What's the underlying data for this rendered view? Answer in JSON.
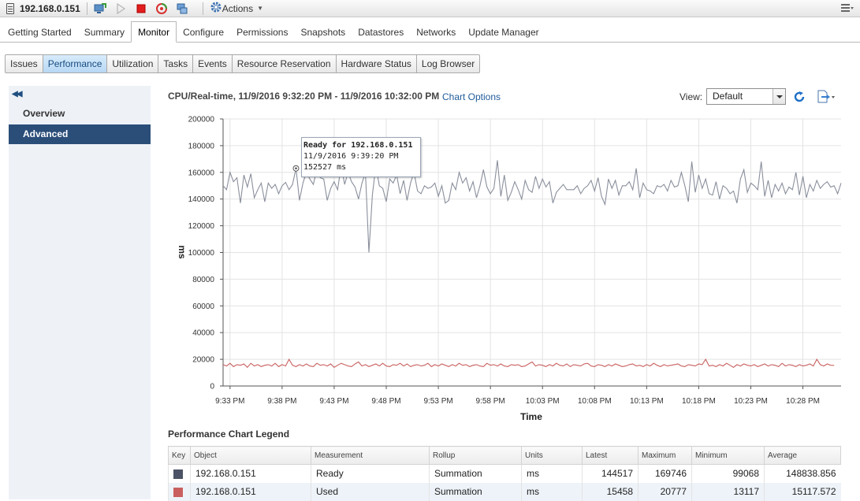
{
  "header": {
    "host_title": "192.168.0.151",
    "actions_label": "Actions",
    "icons": [
      "host-icon",
      "vm-console-icon",
      "power-on-icon",
      "power-off-icon",
      "restart-icon",
      "migrate-icon",
      "gear-icon",
      "chevron-down-icon",
      "menu-icon"
    ]
  },
  "main_tabs": [
    {
      "label": "Getting Started"
    },
    {
      "label": "Summary"
    },
    {
      "label": "Monitor",
      "active": true
    },
    {
      "label": "Configure"
    },
    {
      "label": "Permissions"
    },
    {
      "label": "Snapshots"
    },
    {
      "label": "Datastores"
    },
    {
      "label": "Networks"
    },
    {
      "label": "Update Manager"
    }
  ],
  "sub_tabs": [
    {
      "label": "Issues"
    },
    {
      "label": "Performance",
      "active": true
    },
    {
      "label": "Utilization"
    },
    {
      "label": "Tasks"
    },
    {
      "label": "Events"
    },
    {
      "label": "Resource Reservation"
    },
    {
      "label": "Hardware Status"
    },
    {
      "label": "Log Browser"
    }
  ],
  "side_nav": {
    "items": [
      {
        "label": "Overview"
      },
      {
        "label": "Advanced",
        "active": true
      }
    ]
  },
  "chart_header": {
    "title": "CPU/Real-time, 11/9/2016 9:32:20 PM - 11/9/2016 10:32:00 PM",
    "chart_options_label": "Chart Options",
    "view_label": "View:",
    "view_value": "Default"
  },
  "tooltip": {
    "title": "Ready for 192.168.0.151",
    "time": "11/9/2016 9:39:20 PM",
    "value": "152527 ms"
  },
  "chart_data": {
    "type": "line",
    "title": "CPU/Real-time, 11/9/2016 9:32:20 PM - 11/9/2016 10:32:00 PM",
    "xlabel": "Time",
    "ylabel": "ms",
    "ylim": [
      0,
      200000
    ],
    "yticks": [
      0,
      20000,
      40000,
      60000,
      80000,
      100000,
      120000,
      140000,
      160000,
      180000,
      200000
    ],
    "x_range": [
      "9:32:20 PM",
      "10:32:00 PM"
    ],
    "x_interval_seconds": 20,
    "xticks": [
      "9:33 PM",
      "9:38 PM",
      "9:43 PM",
      "9:48 PM",
      "9:53 PM",
      "9:58 PM",
      "10:03 PM",
      "10:08 PM",
      "10:13 PM",
      "10:18 PM",
      "10:23 PM",
      "10:28 PM"
    ],
    "grid": true,
    "series": [
      {
        "name": "Ready",
        "color": "#8a8f9c",
        "values": [
          150000,
          147000,
          160000,
          153000,
          156000,
          137000,
          158000,
          149000,
          159000,
          141000,
          147000,
          152000,
          138000,
          152000,
          148000,
          151000,
          144000,
          150000,
          152527,
          147000,
          151000,
          163000,
          139000,
          152000,
          160000,
          155000,
          151000,
          162000,
          156000,
          155000,
          139000,
          148000,
          153000,
          147000,
          165000,
          151000,
          160000,
          153000,
          149000,
          140000,
          152000,
          160000,
          100000,
          143000,
          165000,
          150000,
          148000,
          138000,
          155000,
          152000,
          158000,
          144000,
          154000,
          139000,
          152000,
          160000,
          146000,
          144000,
          150000,
          148000,
          149000,
          152000,
          142000,
          150000,
          137000,
          139000,
          152000,
          147000,
          160000,
          152000,
          156000,
          146000,
          153000,
          141000,
          150000,
          162000,
          149000,
          144000,
          148000,
          169000,
          142000,
          158000,
          139000,
          145000,
          153000,
          147000,
          140000,
          154000,
          147000,
          145000,
          157000,
          148000,
          155000,
          149000,
          153000,
          137000,
          145000,
          148000,
          151000,
          147000,
          147000,
          147000,
          150000,
          144000,
          148000,
          150000,
          154000,
          146000,
          156000,
          142000,
          136000,
          155000,
          148000,
          154000,
          143000,
          150000,
          150000,
          153000,
          147000,
          163000,
          141000,
          152000,
          147000,
          146000,
          144000,
          150000,
          149000,
          151000,
          146000,
          154000,
          149000,
          150000,
          160000,
          150000,
          138000,
          168000,
          145000,
          158000,
          148000,
          155000,
          144000,
          143000,
          153000,
          140000,
          150000,
          148000,
          144000,
          146000,
          137000,
          155000,
          162000,
          145000,
          152000,
          150000,
          147000,
          168000,
          142000,
          154000,
          141000,
          151000,
          146000,
          152000,
          144000,
          149000,
          147000,
          160000,
          143000,
          157000,
          141000,
          151000,
          146000,
          154000,
          148000,
          151000,
          153000,
          149000,
          150000,
          144000,
          152000
        ],
        "legend": {
          "object": "192.168.0.151",
          "measurement": "Ready",
          "rollup": "Summation",
          "units": "ms",
          "latest": "144517",
          "maximum": "169746",
          "minimum": "99068",
          "average": "148838.856"
        }
      },
      {
        "name": "Used",
        "color": "#c9605f",
        "values": [
          16000,
          15000,
          17000,
          14500,
          16000,
          15500,
          16500,
          14000,
          17000,
          15000,
          16000,
          14500,
          15500,
          16000,
          15000,
          17000,
          14500,
          16000,
          15000,
          20000,
          15500,
          14500,
          16000,
          15000,
          16500,
          15000,
          14500,
          17000,
          15500,
          16000,
          15000,
          16500,
          14000,
          15500,
          17000,
          16000,
          15000,
          14500,
          16500,
          18000,
          15000,
          16000,
          14500,
          15500,
          16500,
          15000,
          17000,
          15000,
          14500,
          16000,
          15500,
          17000,
          15000,
          16500,
          14500,
          15500,
          16000,
          15000,
          15500,
          17000,
          14500,
          16000,
          15000,
          16500,
          15500,
          14500,
          16000,
          15000,
          17000,
          15500,
          16000,
          14500,
          15500,
          16000,
          15000,
          14500,
          17000,
          15500,
          16000,
          15000,
          16500,
          15000,
          14500,
          16000,
          15500,
          16000,
          14500,
          15000,
          16500,
          18000,
          15000,
          16000,
          15500,
          14500,
          16000,
          15000,
          17000,
          15500,
          15000,
          16500,
          14500,
          16000,
          15500,
          15000,
          16500,
          17000,
          15000,
          14500,
          16000,
          15500,
          14500,
          16000,
          15000,
          16500,
          15500,
          14500,
          15000,
          16000,
          16500,
          15000,
          15500,
          14500,
          16000,
          15000,
          17000,
          15500,
          14500,
          16000,
          15000,
          15500,
          16000,
          16500,
          15000,
          14500,
          16000,
          15500,
          15000,
          16500,
          16000,
          20000,
          15000,
          15500,
          14500,
          16000,
          15000,
          17000,
          15500,
          14000,
          16000,
          15000,
          16500,
          15500,
          15000,
          16000,
          14500,
          15500,
          16500,
          15000,
          16000,
          15500,
          14500,
          17000,
          15000,
          16000,
          15500,
          14500,
          16000,
          15000,
          15500,
          16500,
          15000,
          20000,
          16000,
          15000,
          16500,
          15500,
          15458
        ]
      }
    ]
  },
  "legend": {
    "title": "Performance Chart Legend",
    "columns": [
      "Key",
      "Object",
      "Measurement",
      "Rollup",
      "Units",
      "Latest",
      "Maximum",
      "Minimum",
      "Average"
    ],
    "rows": [
      {
        "key_color": "#4d5366",
        "object": "192.168.0.151",
        "measurement": "Ready",
        "rollup": "Summation",
        "units": "ms",
        "latest": "144517",
        "maximum": "169746",
        "minimum": "99068",
        "average": "148838.856"
      },
      {
        "key_color": "#c9605f",
        "object": "192.168.0.151",
        "measurement": "Used",
        "rollup": "Summation",
        "units": "ms",
        "latest": "15458",
        "maximum": "20777",
        "minimum": "13117",
        "average": "15117.572"
      }
    ]
  }
}
